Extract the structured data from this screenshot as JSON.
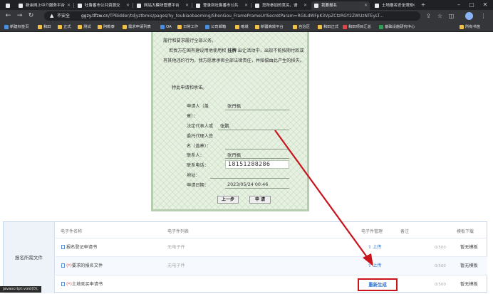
{
  "browser": {
    "tabs": [
      {
        "label": "新余网上中介服务平台"
      },
      {
        "label": "吐鲁番市公共资源交"
      },
      {
        "label": "网站大模块管理平台"
      },
      {
        "label": "登录到吐鲁番市公共"
      },
      {
        "label": "您所参加的竞买，请"
      },
      {
        "label": "我要报名"
      },
      {
        "label": "土地报名安全须知"
      }
    ],
    "insecure_label": "不安全",
    "url_host": "ggzy.tlfzw.cn",
    "url_path": "/TPBidder/tdjyztbmis/pages/hy_toubiaobaoming/ShenGou_FramePrameUrlSecretParam=RGILdWFpK3VpZCtzRGY2ZWUzNTEyLT...",
    "bookmarks": [
      "新建标签页",
      "和田",
      "正式",
      "测试",
      "阿勒泰",
      "需求申请列表",
      "OA",
      "日常工作",
      "公司邮箱",
      "喀城",
      "新疆高效平台",
      "自治区",
      "和田正式",
      "和田项目汇总",
      "基础设施研究中心"
    ],
    "bookmarks_right": "所有书签"
  },
  "certificate": {
    "line1": "履行和要求履行全部义务。",
    "line2_pre": "若我方在国有建设用地使用权",
    "line2_bold": "挂牌",
    "line2_post": "出让活动中，出现不能按期付款或",
    "line3": "有其他违约行为，我方愿意承担全部法律责任，并赔偿由此产生的损失。",
    "line4": "特此申请和承诺。",
    "applicant_label_1": "申请人（盖",
    "applicant_label_2": "章）：",
    "applicant_value": "张丹枫",
    "legal_label": "法定代表人或",
    "legal_value": "张鹏",
    "agent_label_1": "委托代理人签",
    "agent_label_2": "名（盖章）：",
    "contact_label": "联系人：",
    "contact_value": "张丹枫",
    "phone_label": "联系电话：",
    "phone_value": "18151288286",
    "address_label": "地址：",
    "date_label": "申请日期：",
    "date_value": "2023/05/24 00:46",
    "prev_button": "上一步",
    "apply_button": "申 请"
  },
  "attachments": {
    "section_label": "报名所需文件",
    "headers": {
      "name": "电子件名称",
      "list": "电子件列表",
      "manage": "电子件管理",
      "note": "备注",
      "template": "模板下载"
    },
    "rows": [
      {
        "required": false,
        "name": "报名登记申请书",
        "list": "无电子件",
        "action": "上传",
        "count": "0/500",
        "template": "暂无模板"
      },
      {
        "required": true,
        "name": "要求的报名文件",
        "list": "无电子件",
        "action": "上传",
        "count": "0/500",
        "template": "暂无模板"
      },
      {
        "required": true,
        "name": "土地竞买申请书",
        "list": "",
        "action": "重新生成",
        "count": "0/500",
        "template": "暂无模板"
      }
    ],
    "required_mark": "(*)"
  },
  "status_bar": "javascript:void(0);",
  "colors": {
    "highlight": "#c9141c",
    "link": "#2c6fc9"
  }
}
